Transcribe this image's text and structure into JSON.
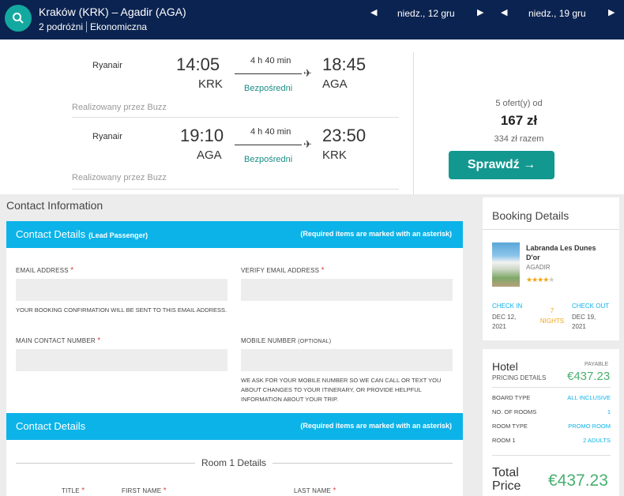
{
  "search": {
    "route": "Kraków (KRK) – Agadir (AGA)",
    "passengers": "2 podróżni",
    "cabin": "Ekonomiczna",
    "depart_date": "niedz., 12 gru",
    "return_date": "niedz., 19 gru"
  },
  "flights": [
    {
      "airline": "Ryanair",
      "dep_time": "14:05",
      "dep_code": "KRK",
      "duration": "4 h 40 min",
      "stops": "Bezpośredni",
      "arr_time": "18:45",
      "arr_code": "AGA",
      "operated_by": "Realizowany przez Buzz"
    },
    {
      "airline": "Ryanair",
      "dep_time": "19:10",
      "dep_code": "AGA",
      "duration": "4 h 40 min",
      "stops": "Bezpośredni",
      "arr_time": "23:50",
      "arr_code": "KRK",
      "operated_by": "Realizowany przez Buzz"
    }
  ],
  "offer": {
    "offers_count": "5 ofert(y) od",
    "price": "167 zł",
    "total": "334 zł razem",
    "button": "Sprawdź →"
  },
  "contact": {
    "section_title": "Contact Information",
    "bar1_title": "Contact Details",
    "bar1_sub": "(Lead Passenger)",
    "required_note": "(Required items are marked with an asterisk)",
    "email_label": "EMAIL ADDRESS",
    "verify_label": "VERIFY EMAIL ADDRESS",
    "email_note": "YOUR BOOKING CONFIRMATION WILL BE SENT TO THIS EMAIL ADDRESS.",
    "main_number_label": "MAIN CONTACT NUMBER",
    "mobile_label": "MOBILE NUMBER",
    "mobile_optional": "(OPTIONAL)",
    "mobile_note": "WE ASK FOR YOUR MOBILE NUMBER SO WE CAN CALL OR TEXT YOU ABOUT CHANGES TO YOUR ITINERARY, OR PROVIDE HELPFUL INFORMATION ABOUT YOUR TRIP.",
    "asterisk": "*",
    "bar2_title": "Contact Details",
    "room_title": "Room 1 Details",
    "title_label": "TITLE",
    "first_name_label": "FIRST NAME",
    "last_name_label": "LAST NAME"
  },
  "booking": {
    "title": "Booking Details",
    "hotel_name": "Labranda Les Dunes D'or",
    "hotel_city": "AGADIR",
    "stars_on": "★★★★",
    "stars_off": "★",
    "check_in_label": "CHECK IN",
    "check_in_date": "DEC 12, 2021",
    "nights_count": "7",
    "nights_label": "NIGHTS",
    "check_out_label": "CHECK OUT",
    "check_out_date": "DEC 19, 2021"
  },
  "pricing": {
    "hotel": "Hotel",
    "payable": "PAYABLE",
    "pricing_details": "PRICING DETAILS",
    "price": "€437.23",
    "rows": [
      {
        "label": "BOARD TYPE",
        "value": "ALL INCLUSIVE"
      },
      {
        "label": "NO. OF ROOMS",
        "value": "1"
      },
      {
        "label": "ROOM TYPE",
        "value": "PROMO ROOM"
      },
      {
        "label": "ROOM 1",
        "value": "2 ADULTS"
      }
    ],
    "total_label": "Total Price",
    "total_price": "€437.23"
  },
  "colors": {
    "navy": "#0b2350",
    "teal": "#13988f",
    "cyan": "#0cb3e8",
    "green": "#47b06f"
  }
}
